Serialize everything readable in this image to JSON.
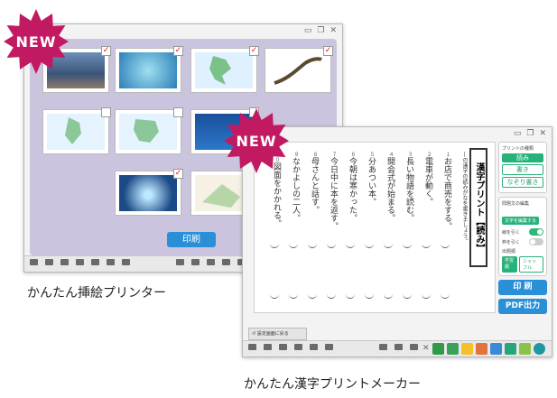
{
  "badges": {
    "new_label": "NEW"
  },
  "window1": {
    "print_label": "印刷",
    "toolbar_colors": [
      "#2f9a4a",
      "#f4c02a",
      "#e3733c",
      "#3a8ad6"
    ],
    "thumbnails": [
      {
        "checked": true
      },
      {
        "checked": true
      },
      {
        "checked": true
      },
      {
        "checked": true
      },
      {
        "checked": false
      },
      {
        "checked": false
      },
      {
        "checked": false
      },
      {
        "checked": true
      },
      {
        "checked": true
      }
    ]
  },
  "captions": {
    "illustration": "かんたん挿絵プリンター",
    "kanji": "かんたん漢字プリントメーカー"
  },
  "window2": {
    "sheet_title": "漢字プリント【読み】",
    "instruction": "―の漢字の読みがなを書きましょう。",
    "sentences": [
      {
        "num": "１",
        "text": "お店で商売をする。"
      },
      {
        "num": "２",
        "text": "電車が動く。"
      },
      {
        "num": "３",
        "text": "長い物語を読む。"
      },
      {
        "num": "４",
        "text": "開会式が始まる。"
      },
      {
        "num": "５",
        "text": "分あつい本。"
      },
      {
        "num": "６",
        "text": "今朝は寒かった。"
      },
      {
        "num": "７",
        "text": "今日中に本を返す。"
      },
      {
        "num": "８",
        "text": "母さんと話す。"
      },
      {
        "num": "９",
        "text": "なかよしの二人。"
      },
      {
        "num": "１０",
        "text": "図面をかかれる。"
      }
    ],
    "sidebar": {
      "print_type_label": "プリントの種類",
      "types": [
        "読み",
        "書き",
        "なぞり書き"
      ],
      "edit_label": "問題文の編集",
      "edit_button": "文字を編集する",
      "underline_label": "線を引く",
      "frame_label": "枠を引く",
      "order_label": "出題順",
      "order_options": [
        "学習順",
        "シャッフル"
      ],
      "print_button": "印 刷",
      "pdf_button": "PDF出力"
    },
    "back_button": "設定画面に戻る"
  }
}
